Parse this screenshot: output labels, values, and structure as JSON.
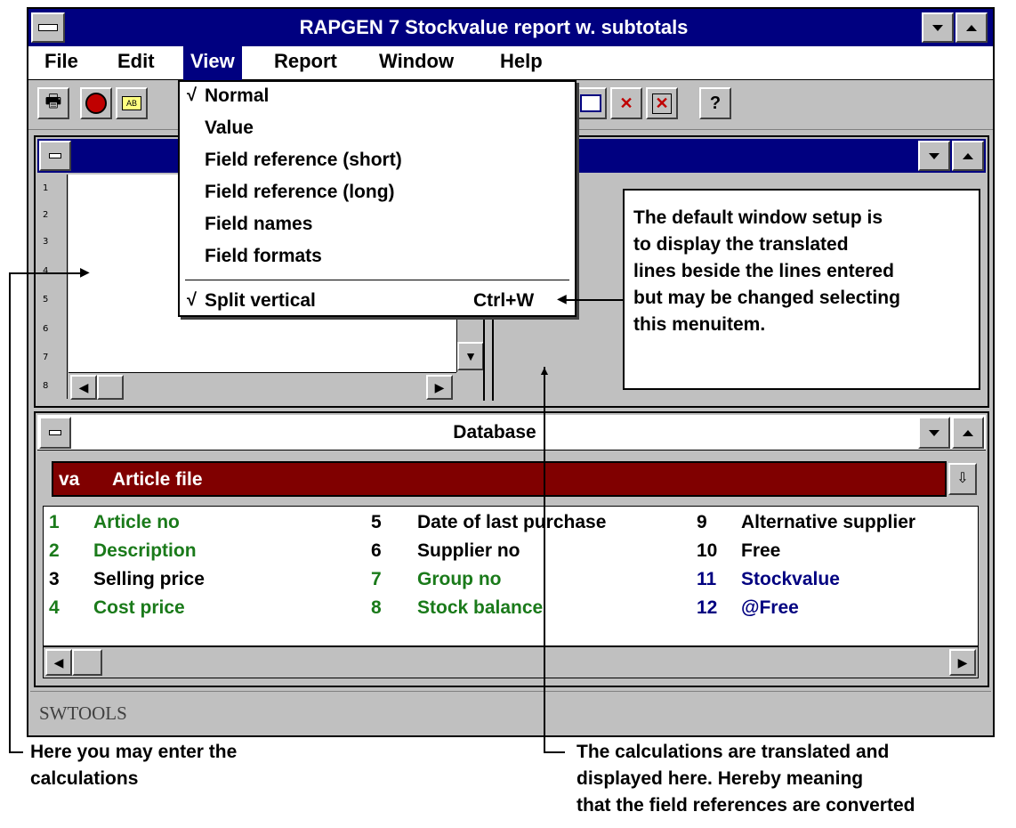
{
  "window": {
    "title": "RAPGEN 7 Stockvalue report w. subtotals"
  },
  "menubar": [
    "File",
    "Edit",
    "View",
    "Report",
    "Window",
    "Help"
  ],
  "view_menu": {
    "items": [
      "Normal",
      "Value",
      "Field reference (short)",
      "Field reference (long)",
      "Field names",
      "Field formats"
    ],
    "split_label": "Split vertical",
    "split_shortcut": "Ctrl+W",
    "check": "√"
  },
  "toolbar": {
    "help_button": "?"
  },
  "editor": {
    "line_numbers": [
      "1",
      "2",
      "3",
      "4",
      "5",
      "6",
      "7",
      "8"
    ]
  },
  "callout_right": {
    "lines": [
      "The default window setup is",
      "to display the translated",
      "lines beside the lines entered",
      "but may be changed selecting",
      "this menuitem."
    ]
  },
  "database": {
    "title": "Database",
    "file_code": "va",
    "file_name": "Article file",
    "fields": [
      {
        "num": "1",
        "name": "Article no",
        "color": "#1a7a1a"
      },
      {
        "num": "2",
        "name": "Description",
        "color": "#1a7a1a"
      },
      {
        "num": "3",
        "name": "Selling price",
        "color": "#000000"
      },
      {
        "num": "4",
        "name": "Cost price",
        "color": "#1a7a1a"
      },
      {
        "num": "5",
        "name": "Date of last purchase",
        "color": "#000000"
      },
      {
        "num": "6",
        "name": "Supplier no",
        "color": "#000000"
      },
      {
        "num": "7",
        "name": "Group no",
        "color": "#1a7a1a"
      },
      {
        "num": "8",
        "name": "Stock balance",
        "color": "#1a7a1a"
      },
      {
        "num": "9",
        "name": "Alternative supplier",
        "color": "#000000"
      },
      {
        "num": "10",
        "name": "Free",
        "color": "#000000"
      },
      {
        "num": "11",
        "name": "Stockvalue",
        "color": "#000080"
      },
      {
        "num": "12",
        "name": "@Free",
        "color": "#000080"
      }
    ]
  },
  "statusbar": {
    "text": "SWTOOLS"
  },
  "callout_bottom_left": {
    "lines": [
      "Here you may enter the",
      "calculations"
    ]
  },
  "callout_bottom_right": {
    "lines": [
      "The calculations are translated and",
      "displayed here. Hereby meaning",
      "that the field references are converted"
    ]
  }
}
